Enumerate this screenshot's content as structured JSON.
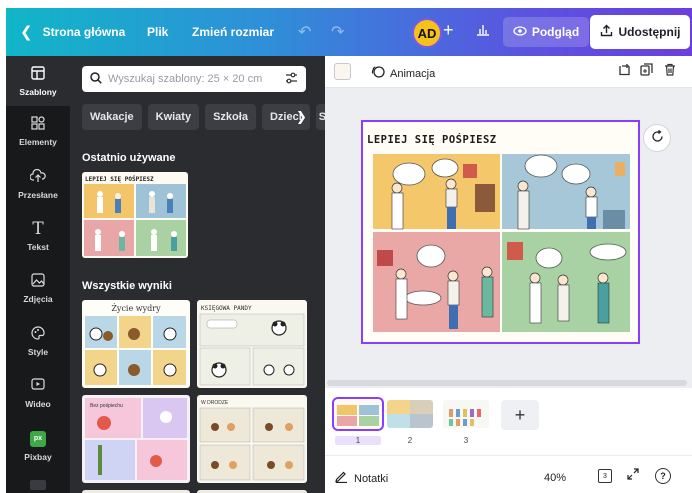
{
  "topbar": {
    "home_label": "Strona główna",
    "file_label": "Plik",
    "resize_label": "Zmień rozmiar",
    "undo_icon": "undo-icon",
    "redo_icon": "redo-icon",
    "avatar_initials": "AD",
    "preview_label": "Podgląd",
    "share_label": "Udostępnij"
  },
  "rail": {
    "items": [
      {
        "label": "Szablony",
        "icon": "template-icon"
      },
      {
        "label": "Elementy",
        "icon": "elements-icon"
      },
      {
        "label": "Przesłane",
        "icon": "upload-icon"
      },
      {
        "label": "Tekst",
        "icon": "text-icon"
      },
      {
        "label": "Zdjęcia",
        "icon": "photo-icon"
      },
      {
        "label": "Style",
        "icon": "palette-icon"
      },
      {
        "label": "Wideo",
        "icon": "video-icon"
      },
      {
        "label": "Pixbay",
        "icon": "pixbay-icon"
      }
    ]
  },
  "panel": {
    "search_placeholder": "Wyszukaj szablony: 25 × 20 cm",
    "chips": [
      "Wakacje",
      "Kwiaty",
      "Szkoła",
      "Dzieci",
      "Sp"
    ],
    "recent_title": "Ostatnio używane",
    "all_title": "Wszystkie wyniki",
    "results": [
      {
        "caption": "Życie wydry"
      },
      {
        "caption": "KSIĘGOWA PANDY"
      },
      {
        "caption": "Bez pośpiechu"
      },
      {
        "caption": "W DRODZE"
      }
    ]
  },
  "editor": {
    "animation_label": "Animacja",
    "page_title": "LEPIEJ SIĘ POŚPIESZ",
    "pages": [
      {
        "number": "1"
      },
      {
        "number": "2"
      },
      {
        "number": "3"
      }
    ],
    "add_page_label": "+"
  },
  "footer": {
    "notes_label": "Notatki",
    "zoom": "40%",
    "page_count": "3"
  },
  "colors": {
    "accent": "#8b3dff",
    "rail_bg": "#18191b",
    "panel_bg": "#2b2c30"
  }
}
